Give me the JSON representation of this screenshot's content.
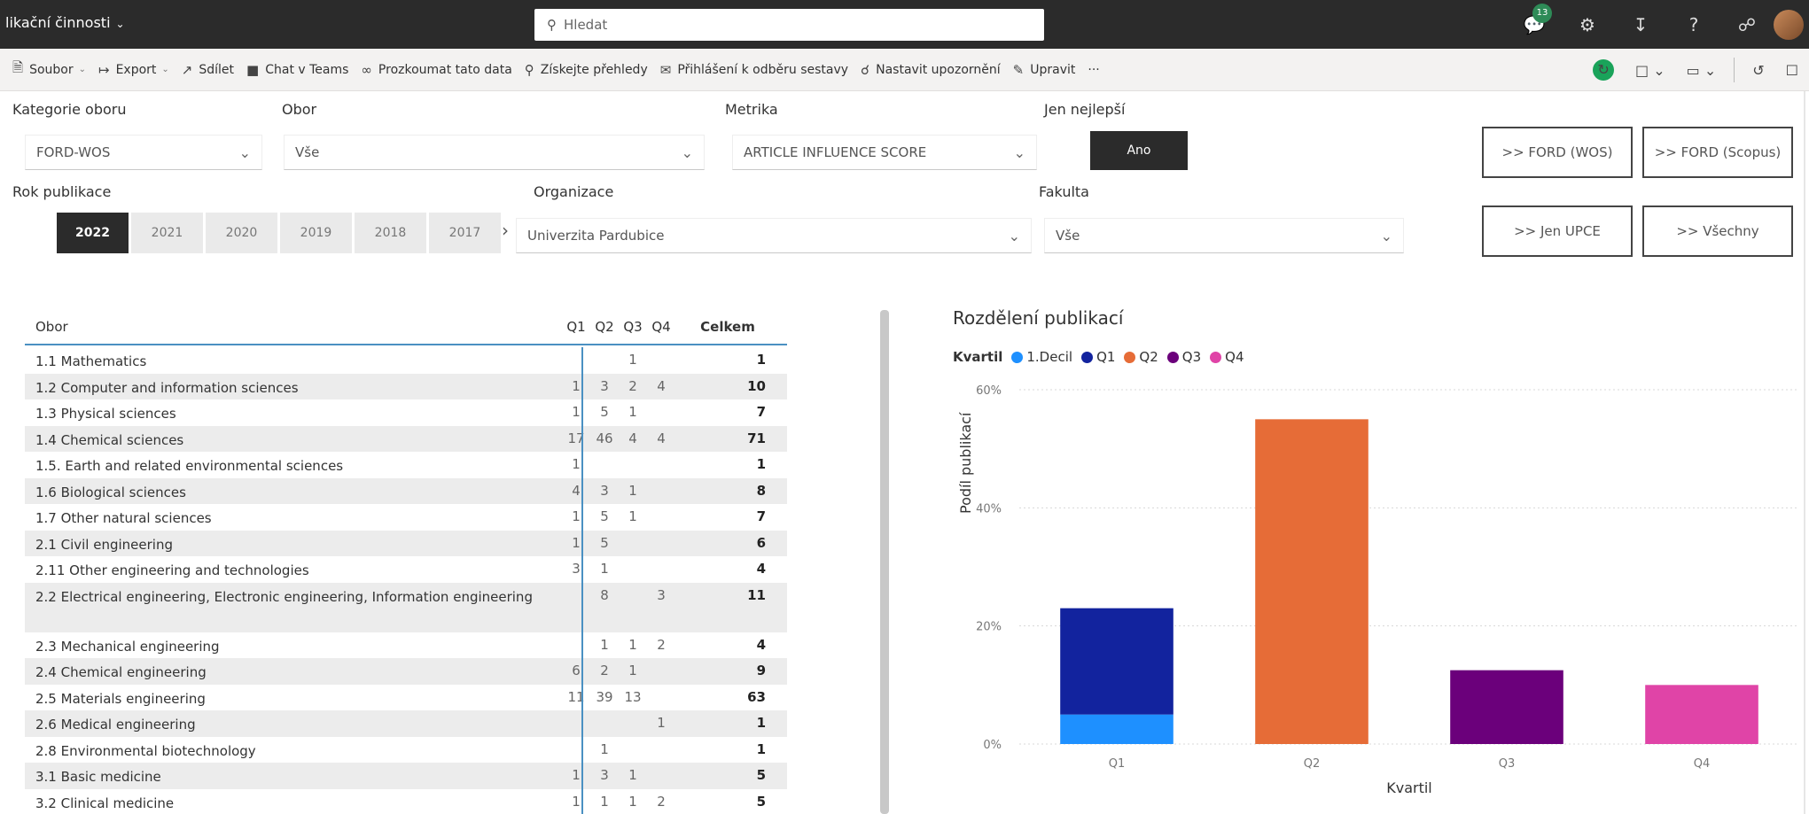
{
  "titlebar": {
    "title": "likační činnosti",
    "search_placeholder": "Hledat",
    "badge_count": "13"
  },
  "commands": [
    {
      "label": "Soubor",
      "icon": "file-icon",
      "dropdown": true
    },
    {
      "label": "Export",
      "icon": "export-icon",
      "dropdown": true
    },
    {
      "label": "Sdílet",
      "icon": "share-icon",
      "dropdown": false
    },
    {
      "label": "Chat v Teams",
      "icon": "teams-icon",
      "dropdown": false
    },
    {
      "label": "Prozkoumat tato data",
      "icon": "explore-icon",
      "dropdown": false
    },
    {
      "label": "Získejte přehledy",
      "icon": "insights-icon",
      "dropdown": false
    },
    {
      "label": "Přihlášení k odběru sestavy",
      "icon": "subscribe-icon",
      "dropdown": false
    },
    {
      "label": "Nastavit upozornění",
      "icon": "bell-icon",
      "dropdown": false
    },
    {
      "label": "Upravit",
      "icon": "pencil-icon",
      "dropdown": false
    },
    {
      "label": "···",
      "icon": "more-icon",
      "dropdown": false
    }
  ],
  "filters": {
    "kategorie_label": "Kategorie oboru",
    "kategorie_value": "FORD-WOS",
    "obor_label": "Obor",
    "obor_value": "Vše",
    "metrika_label": "Metrika",
    "metrika_value": "ARTICLE INFLUENCE SCORE",
    "jen_label": "Jen nejlepší",
    "jen_value": "Ano",
    "rok_label": "Rok publikace",
    "years": [
      "2022",
      "2021",
      "2020",
      "2019",
      "2018",
      "2017"
    ],
    "active_year": "2022",
    "organizace_label": "Organizace",
    "organizace_value": "Univerzita Pardubice",
    "fakulta_label": "Fakulta",
    "fakulta_value": "Vše"
  },
  "nav_buttons": {
    "ford_wos": ">> FORD (WOS)",
    "ford_scopus": ">> FORD (Scopus)",
    "jen_upce": ">> Jen UPCE",
    "vsechny": ">> Všechny"
  },
  "table": {
    "headers": {
      "name": "Obor",
      "q1": "Q1",
      "q2": "Q2",
      "q3": "Q3",
      "q4": "Q4",
      "total": "Celkem"
    },
    "rows": [
      {
        "name": "1.1 Mathematics",
        "q1": "",
        "q2": "",
        "q3": "1",
        "q4": "",
        "total": "1"
      },
      {
        "name": "1.2 Computer and information sciences",
        "q1": "1",
        "q2": "3",
        "q3": "2",
        "q4": "4",
        "total": "10"
      },
      {
        "name": "1.3 Physical sciences",
        "q1": "1",
        "q2": "5",
        "q3": "1",
        "q4": "",
        "total": "7"
      },
      {
        "name": "1.4 Chemical sciences",
        "q1": "17",
        "q2": "46",
        "q3": "4",
        "q4": "4",
        "total": "71"
      },
      {
        "name": "1.5. Earth and related environmental sciences",
        "q1": "1",
        "q2": "",
        "q3": "",
        "q4": "",
        "total": "1"
      },
      {
        "name": "1.6 Biological sciences",
        "q1": "4",
        "q2": "3",
        "q3": "1",
        "q4": "",
        "total": "8"
      },
      {
        "name": "1.7 Other natural sciences",
        "q1": "1",
        "q2": "5",
        "q3": "1",
        "q4": "",
        "total": "7"
      },
      {
        "name": "2.1 Civil engineering",
        "q1": "1",
        "q2": "5",
        "q3": "",
        "q4": "",
        "total": "6"
      },
      {
        "name": "2.11 Other engineering and technologies",
        "q1": "3",
        "q2": "1",
        "q3": "",
        "q4": "",
        "total": "4"
      },
      {
        "name": "2.2 Electrical engineering, Electronic engineering, Information engineering",
        "q1": "",
        "q2": "8",
        "q3": "",
        "q4": "3",
        "total": "11"
      },
      {
        "name": "2.3 Mechanical engineering",
        "q1": "",
        "q2": "1",
        "q3": "1",
        "q4": "2",
        "total": "4"
      },
      {
        "name": "2.4 Chemical engineering",
        "q1": "6",
        "q2": "2",
        "q3": "1",
        "q4": "",
        "total": "9"
      },
      {
        "name": "2.5 Materials engineering",
        "q1": "11",
        "q2": "39",
        "q3": "13",
        "q4": "",
        "total": "63"
      },
      {
        "name": "2.6 Medical engineering",
        "q1": "",
        "q2": "",
        "q3": "",
        "q4": "1",
        "total": "1"
      },
      {
        "name": "2.8 Environmental biotechnology",
        "q1": "",
        "q2": "1",
        "q3": "",
        "q4": "",
        "total": "1"
      },
      {
        "name": "3.1 Basic medicine",
        "q1": "1",
        "q2": "3",
        "q3": "1",
        "q4": "",
        "total": "5"
      },
      {
        "name": "3.2 Clinical medicine",
        "q1": "1",
        "q2": "1",
        "q3": "1",
        "q4": "2",
        "total": "5"
      }
    ]
  },
  "chart_data": {
    "type": "bar",
    "title": "Rozdělení publikací",
    "legend_title": "Kvartil",
    "legend": [
      {
        "name": "1.Decil",
        "color": "#1e90ff"
      },
      {
        "name": "Q1",
        "color": "#12239e"
      },
      {
        "name": "Q2",
        "color": "#e66c37"
      },
      {
        "name": "Q3",
        "color": "#6b007b"
      },
      {
        "name": "Q4",
        "color": "#e044a7"
      }
    ],
    "categories": [
      "Q1",
      "Q2",
      "Q3",
      "Q4"
    ],
    "series": [
      {
        "name": "1.Decil",
        "values": [
          5,
          0,
          0,
          0
        ],
        "color": "#1e90ff"
      },
      {
        "name": "Q1",
        "values": [
          18,
          0,
          0,
          0
        ],
        "color": "#12239e"
      },
      {
        "name": "Q2",
        "values": [
          0,
          55,
          0,
          0
        ],
        "color": "#e66c37"
      },
      {
        "name": "Q3",
        "values": [
          0,
          0,
          12.5,
          0
        ],
        "color": "#6b007b"
      },
      {
        "name": "Q4",
        "values": [
          0,
          0,
          0,
          10
        ],
        "color": "#e044a7"
      }
    ],
    "stacked": true,
    "ylim": [
      0,
      60
    ],
    "yticks": [
      "0%",
      "20%",
      "40%",
      "60%"
    ],
    "xlabel": "Kvartil",
    "ylabel": "Podíl publikací",
    "legend_position": "top-left"
  }
}
